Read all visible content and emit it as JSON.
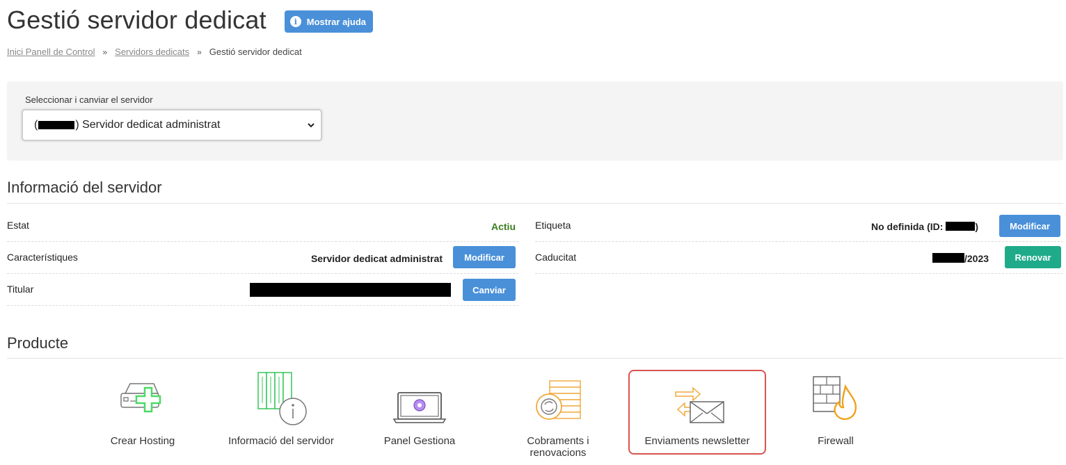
{
  "header": {
    "title": "Gestió servidor dedicat",
    "help_label": "Mostrar ajuda"
  },
  "breadcrumb": {
    "items": [
      "Inici Panell de Control",
      "Servidors dedicats",
      "Gestió servidor dedicat"
    ],
    "separator": "»"
  },
  "server_selector": {
    "label": "Seleccionar i canviar el servidor",
    "selected_prefix": "(",
    "selected_suffix": ") Servidor dedicat administrat"
  },
  "server_info": {
    "title": "Informació del servidor",
    "left_rows": [
      {
        "label": "Estat",
        "value": "Actiu",
        "value_color": "#3a7d1e"
      },
      {
        "label": "Característiques",
        "value": "Servidor dedicat administrat",
        "button": "Modificar"
      },
      {
        "label": "Titular",
        "value": "",
        "button": "Canviar"
      }
    ],
    "right_rows": [
      {
        "label": "Etiqueta",
        "value_prefix": "No definida (ID: ",
        "value_suffix": ")",
        "button": "Modificar"
      },
      {
        "label": "Caducitat",
        "value": "/2023",
        "button": "Renovar"
      }
    ]
  },
  "product": {
    "title": "Producte",
    "items": [
      {
        "label": "Crear Hosting",
        "icon": "server-add-icon"
      },
      {
        "label": "Informació del servidor",
        "icon": "server-info-icon"
      },
      {
        "label": "Panel Gestiona",
        "icon": "laptop-panel-icon"
      },
      {
        "label": "Cobraments i renovacions",
        "icon": "billing-coins-icon"
      },
      {
        "label": "Enviaments newsletter",
        "icon": "newsletter-envelope-icon",
        "highlighted": true
      },
      {
        "label": "Firewall",
        "icon": "firewall-icon"
      }
    ]
  },
  "colors": {
    "primary_button": "#4a90d9",
    "renew_button": "#1fab8a",
    "highlight_border": "#d9534f",
    "active_status": "#3a7d1e"
  }
}
